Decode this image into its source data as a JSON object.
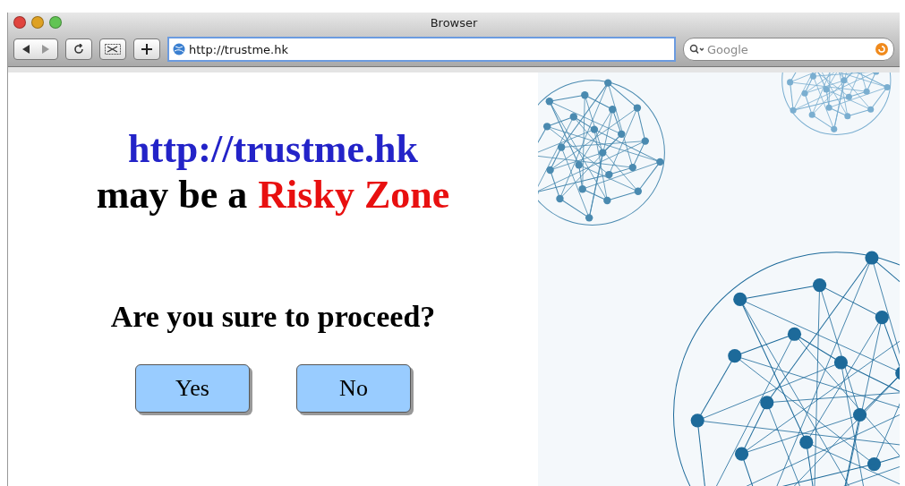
{
  "window": {
    "title": "Browser"
  },
  "toolbar": {
    "address": "http://trustme.hk",
    "search_placeholder": "Google"
  },
  "page": {
    "url": "http://trustme.hk",
    "warning_prefix": "may be a",
    "warning_highlight": "Risky Zone",
    "question": "Are you sure to proceed?",
    "buttons": [
      "Yes",
      "No"
    ]
  }
}
